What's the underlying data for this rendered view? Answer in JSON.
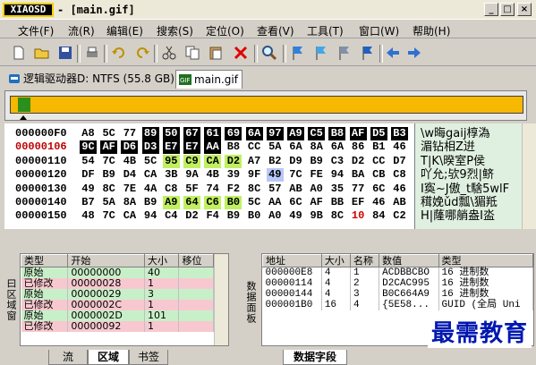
{
  "title": {
    "logo": "XIAOSD",
    "text": "- [main.gif]",
    "buttons": [
      "_",
      "□",
      "×"
    ]
  },
  "menu": [
    "文件(F)",
    "流(R)",
    "编辑(E)",
    "搜索(S)",
    "定位(O)",
    "查看(V)",
    "工具(T)",
    "窗口(W)",
    "帮助(H)"
  ],
  "toolbar_icons": [
    "new-file-icon",
    "open-folder-icon",
    "save-icon",
    "print-icon",
    "undo-icon",
    "redo-icon",
    "cut-icon",
    "copy-icon",
    "paste-icon",
    "delete-icon",
    "find-icon",
    "flag-blue-icon",
    "flag-cyan-icon",
    "flag-gray-icon",
    "flag-navy-icon",
    "back-arrow-icon",
    "forward-arrow-icon"
  ],
  "tabs": {
    "drive": "逻辑驱动器D: NTFS (55.8 GB)",
    "file": "main.gif"
  },
  "hex": {
    "rows": [
      {
        "addr": "000000F0",
        "bytes": [
          "A8",
          "5C",
          "77",
          "89",
          "50",
          "67",
          "61",
          "69",
          "6A",
          "97",
          "A9",
          "C5",
          "B8",
          "AF",
          "D5",
          "B3"
        ],
        "ascii": "\\w晦gaij椁溈"
      },
      {
        "addr": "00000106",
        "bytes": [
          "9C",
          "AF",
          "D6",
          "D3",
          "E7",
          "E7",
          "AA",
          "B8",
          "CC",
          "5A",
          "6A",
          "8A",
          "6A",
          "86",
          "B1",
          "46"
        ],
        "ascii": "湄钻相Z逬"
      },
      {
        "addr": "00000110",
        "bytes": [
          "54",
          "7C",
          "4B",
          "5C",
          "95",
          "C9",
          "CA",
          "D2",
          "A7",
          "B2",
          "D9",
          "B9",
          "C3",
          "D2",
          "CC",
          "D7"
        ],
        "ascii": "T|K\\暌室P侯"
      },
      {
        "addr": "00000120",
        "bytes": [
          "DF",
          "B9",
          "D4",
          "CA",
          "3B",
          "9A",
          "4B",
          "39",
          "9F",
          "49",
          "7C",
          "FE",
          "94",
          "BA",
          "CB",
          "C8"
        ],
        "ascii": "吖允;欤9烈|鲚"
      },
      {
        "addr": "00000130",
        "bytes": [
          "49",
          "8C",
          "7E",
          "4A",
          "C8",
          "5F",
          "74",
          "F2",
          "8C",
          "57",
          "AB",
          "A0",
          "35",
          "77",
          "6C",
          "46"
        ],
        "ascii": "I寏~J傲_t騇5wlF"
      },
      {
        "addr": "00000140",
        "bytes": [
          "B7",
          "5A",
          "8A",
          "B9",
          "A9",
          "64",
          "C6",
          "B0",
          "5C",
          "AA",
          "6C",
          "AF",
          "BB",
          "EF",
          "46",
          "AB"
        ],
        "ascii": "穁娩ǔd瓢\\猸羝"
      },
      {
        "addr": "00000150",
        "bytes": [
          "48",
          "7C",
          "CA",
          "94",
          "C4",
          "D2",
          "F4",
          "B9",
          "B0",
          "A0",
          "49",
          "9B",
          "8C",
          "10",
          "84",
          "C2"
        ],
        "ascii": "H|蕯哪艄盎I泴"
      }
    ]
  },
  "left_panel": {
    "side_label": "曰区域窗",
    "columns": [
      "类型",
      "开始",
      "大小",
      "移位"
    ],
    "rows": [
      {
        "type": "原始",
        "start": "00000000",
        "size": "40",
        "shift": ""
      },
      {
        "type": "已修改",
        "start": "00000028",
        "size": "1",
        "shift": ""
      },
      {
        "type": "原始",
        "start": "00000029",
        "size": "3",
        "shift": ""
      },
      {
        "type": "已修改",
        "start": "0000002C",
        "size": "1",
        "shift": ""
      },
      {
        "type": "原始",
        "start": "0000002D",
        "size": "101",
        "shift": ""
      },
      {
        "type": "已修改",
        "start": "00000092",
        "size": "1",
        "shift": ""
      }
    ],
    "tabs": [
      "流",
      "区域",
      "书签"
    ]
  },
  "right_panel": {
    "side_label": "数据面板",
    "columns": [
      "地址",
      "大小",
      "名称",
      "数值",
      "类型"
    ],
    "rows": [
      {
        "addr": "000000E8",
        "size": "4",
        "name": "1",
        "value": "ACDBBCBO",
        "type": "16 进制数"
      },
      {
        "addr": "00000114",
        "size": "4",
        "name": "2",
        "value": "D2CAC995",
        "type": "16 进制数"
      },
      {
        "addr": "00000144",
        "size": "4",
        "name": "3",
        "value": "B0C664A9",
        "type": "16 进制数"
      },
      {
        "addr": "000001B0",
        "size": "16",
        "name": "4",
        "value": "{5E58...",
        "type": "GUID (全局 Uni"
      }
    ],
    "tabs": [
      "数据字段"
    ]
  },
  "watermark": "最需教育"
}
